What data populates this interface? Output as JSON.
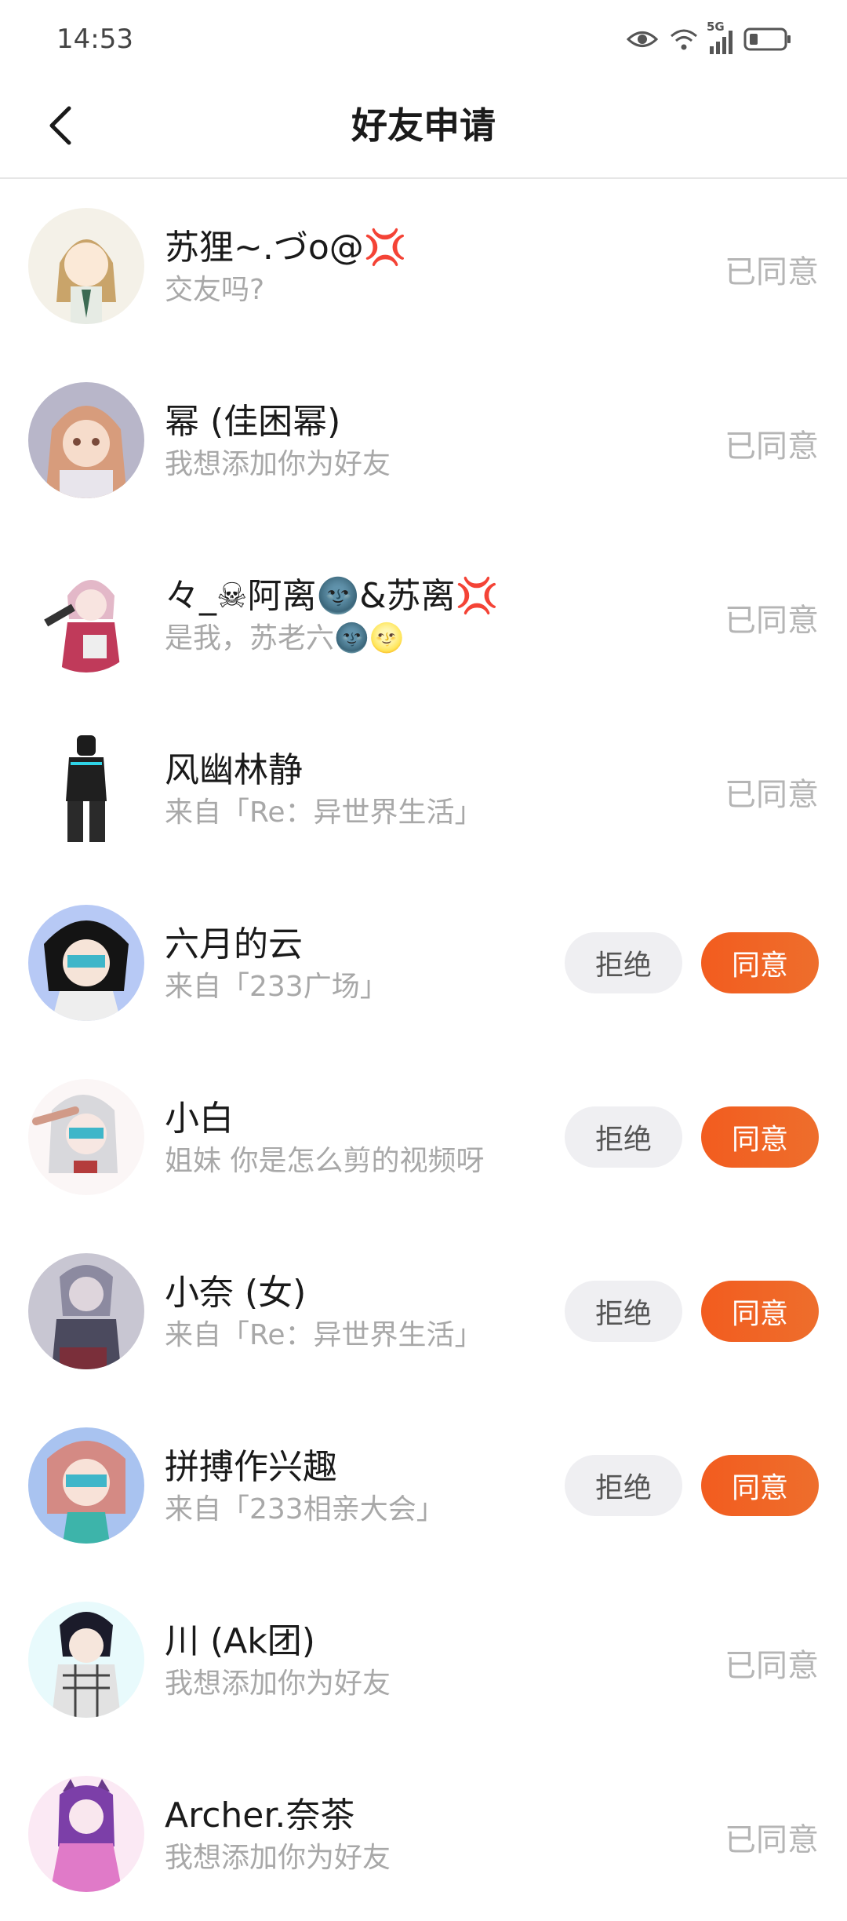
{
  "status_bar": {
    "time": "14:53",
    "network": "5G"
  },
  "header": {
    "title": "好友申请",
    "back_icon": "chevron-left-icon"
  },
  "actions": {
    "reject_label": "拒绝",
    "accept_label": "同意",
    "agreed_label": "已同意"
  },
  "colors": {
    "accent": "#f06022",
    "muted": "#b5b5b5",
    "reject_bg": "#efeff2"
  },
  "requests": [
    {
      "name": "苏狸~.づo@💢",
      "message": "交友吗?",
      "status": "agreed"
    },
    {
      "name": "幂 (佳困幂)",
      "message": "我想添加你为好友",
      "status": "agreed"
    },
    {
      "name": "々_☠阿离🌚&苏离💢",
      "message": "是我，苏老六🌚🌝",
      "status": "agreed"
    },
    {
      "name": "风幽林静",
      "message": "来自「Re：异世界生活」",
      "status": "agreed"
    },
    {
      "name": "六月的云",
      "message": "来自「233广场」",
      "status": "pending"
    },
    {
      "name": "小白",
      "message": "姐妹 你是怎么剪的视频呀",
      "status": "pending"
    },
    {
      "name": "小奈 (女)",
      "message": "来自「Re：异世界生活」",
      "status": "pending"
    },
    {
      "name": "拼搏作兴趣",
      "message": "来自「233相亲大会」",
      "status": "pending"
    },
    {
      "name": "川 (Ak团)",
      "message": "我想添加你为好友",
      "status": "agreed"
    },
    {
      "name": "Archer.奈茶",
      "message": "我想添加你为好友",
      "status": "agreed"
    }
  ]
}
